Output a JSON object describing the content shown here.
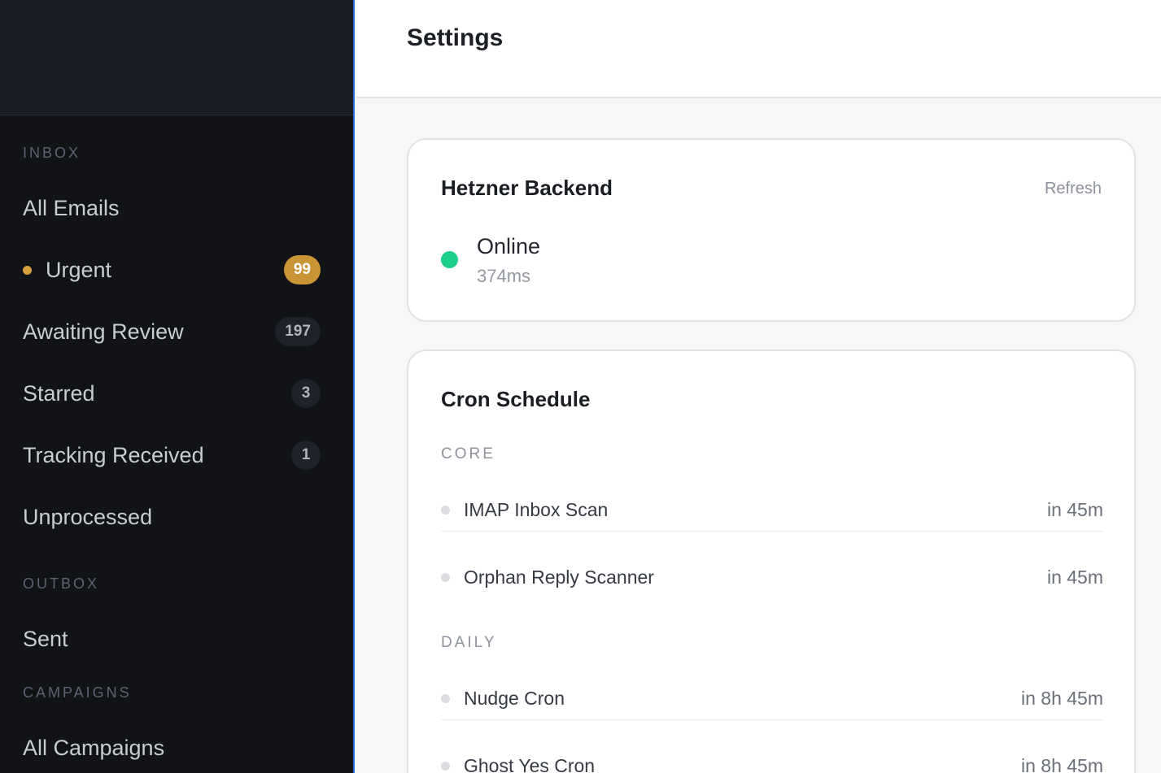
{
  "sidebar": {
    "sections": {
      "inbox": "INBOX",
      "outbox": "OUTBOX",
      "campaigns": "CAMPAIGNS"
    },
    "items": [
      {
        "label": "All Emails"
      },
      {
        "label": "Urgent",
        "badge": "99"
      },
      {
        "label": "Awaiting Review",
        "badge": "197"
      },
      {
        "label": "Starred",
        "badge": "3"
      },
      {
        "label": "Tracking Received",
        "badge": "1"
      },
      {
        "label": "Unprocessed"
      },
      {
        "label": "Sent"
      },
      {
        "label": "All Campaigns"
      }
    ]
  },
  "header": {
    "title": "Settings"
  },
  "backend": {
    "title": "Hetzner Backend",
    "refresh_label": "Refresh",
    "status": "Online",
    "latency": "374ms"
  },
  "cron": {
    "title": "Cron Schedule",
    "groups": [
      {
        "label": "CORE",
        "jobs": [
          {
            "name": "IMAP Inbox Scan",
            "next": "in 45m"
          },
          {
            "name": "Orphan Reply Scanner",
            "next": "in 45m"
          }
        ]
      },
      {
        "label": "DAILY",
        "jobs": [
          {
            "name": "Nudge Cron",
            "next": "in 8h 45m"
          },
          {
            "name": "Ghost Yes Cron",
            "next": "in 8h 45m"
          }
        ]
      }
    ]
  },
  "colors": {
    "accent": "#2a6fd6",
    "urgent": "#c99434",
    "online": "#1ccf8a"
  }
}
